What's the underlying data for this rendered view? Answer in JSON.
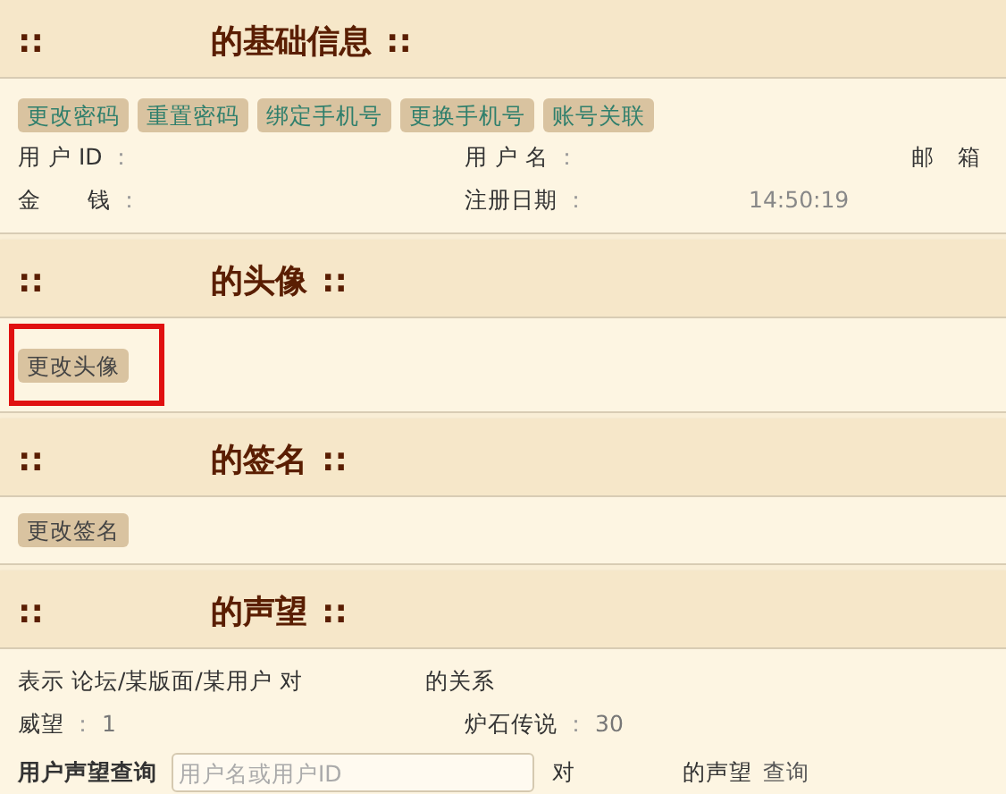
{
  "sections": [
    {
      "marker": "::",
      "title": "的基础信息",
      "end_marker": "::",
      "kind": "info",
      "buttons": [
        {
          "label": "更改密码",
          "kind": "teal",
          "highlighted": false
        },
        {
          "label": "重置密码",
          "kind": "teal",
          "highlighted": false
        },
        {
          "label": "绑定手机号",
          "kind": "teal",
          "highlighted": false
        },
        {
          "label": "更换手机号",
          "kind": "teal",
          "highlighted": false
        },
        {
          "label": "账号关联",
          "kind": "teal",
          "highlighted": false
        }
      ],
      "fields": [
        {
          "label": "用 户 ID",
          "sep": "："
        },
        {
          "label": "用 户 名",
          "sep": "："
        },
        {
          "label": "邮　箱"
        },
        {
          "label": "金　　钱",
          "sep": "："
        },
        {
          "label": "注册日期",
          "sep": "：",
          "value": "14:50:19"
        }
      ]
    },
    {
      "marker": "::",
      "title": "的头像",
      "end_marker": "::",
      "kind": "buttons",
      "buttons": [
        {
          "label": "更改头像",
          "kind": "plain",
          "highlighted": true
        }
      ]
    },
    {
      "marker": "::",
      "title": "的签名",
      "end_marker": "::",
      "kind": "buttons",
      "buttons": [
        {
          "label": "更改签名",
          "kind": "plain",
          "highlighted": false
        }
      ]
    },
    {
      "marker": "::",
      "title": "的声望",
      "end_marker": "::",
      "kind": "reputation",
      "description": [
        "表示 论坛/某版面/某用户 对",
        "的关系"
      ],
      "fields": [
        {
          "label": "威望",
          "sep": "：",
          "value": "1"
        },
        {
          "label": "炉石传说",
          "sep": "：",
          "value": "30"
        }
      ],
      "query": {
        "label": "用户声望查询",
        "placeholder": "用户名或用户ID",
        "middle": "对",
        "suffix": "的声望",
        "action": "查询"
      }
    }
  ]
}
